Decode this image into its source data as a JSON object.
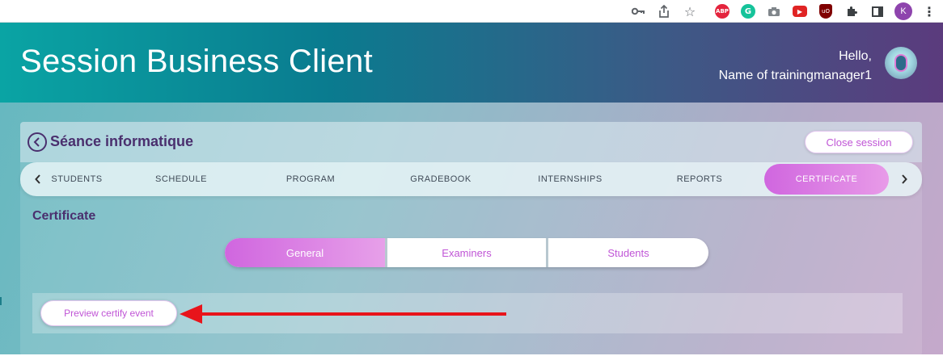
{
  "browser": {
    "profile_initial": "K",
    "extensions": [
      "key-icon",
      "share-icon",
      "star-icon",
      "adblock-icon",
      "grammarly-icon",
      "camera-icon",
      "youtube-icon",
      "ublock-icon",
      "puzzle-icon",
      "sidebar-icon",
      "profile-avatar",
      "kebab-menu-icon"
    ],
    "abp_text": "ABP",
    "grammarly_text": "G",
    "ublock_text": "uO"
  },
  "header": {
    "title": "Session Business Client",
    "greeting_line1": "Hello,",
    "greeting_line2": "Name of trainingmanager1"
  },
  "session": {
    "title": "Séance informatique",
    "close_button": "Close session"
  },
  "tabs": [
    {
      "label": "STUDENTS",
      "active": false
    },
    {
      "label": "SCHEDULE",
      "active": false
    },
    {
      "label": "PROGRAM",
      "active": false
    },
    {
      "label": "GRADEBOOK",
      "active": false
    },
    {
      "label": "INTERNSHIPS",
      "active": false
    },
    {
      "label": "REPORTS",
      "active": false
    },
    {
      "label": "CERTIFICATE",
      "active": true
    }
  ],
  "certificate": {
    "section_title": "Certificate",
    "segments": [
      {
        "label": "General",
        "active": true
      },
      {
        "label": "Examiners",
        "active": false
      },
      {
        "label": "Students",
        "active": false
      }
    ],
    "preview_button": "Preview certify event"
  },
  "colors": {
    "accent": "#c055d6",
    "heading": "#4a2f6e",
    "annotation_arrow": "#e8141b"
  }
}
